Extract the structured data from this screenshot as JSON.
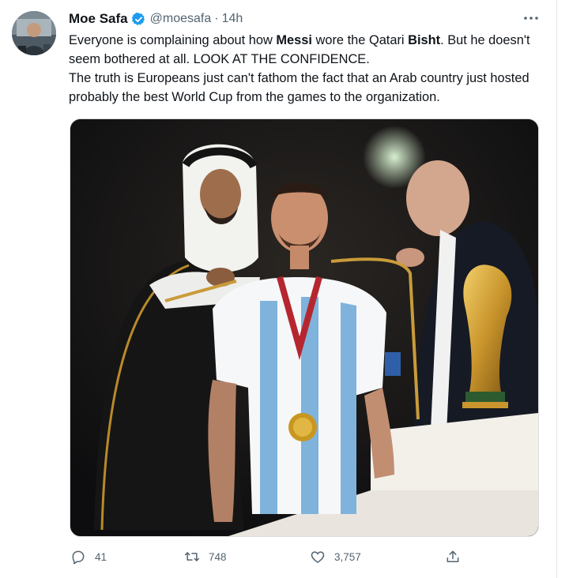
{
  "tweet": {
    "author": {
      "display_name": "Moe Safa",
      "handle": "@moesafa",
      "separator": "·",
      "timestamp": "14h"
    },
    "text": {
      "p1_before_messi": "Everyone is complaining about how ",
      "p1_messi": "Messi",
      "p1_mid": " wore the Qatari ",
      "p1_bisht": "Bisht",
      "p1_after": ". But he doesn't seem bothered at all. LOOK AT THE CONFIDENCE.",
      "p2": "The truth is Europeans just can't fathom the fact that an Arab country just hosted probably the best World Cup from the games to the organization."
    },
    "stats": {
      "replies": "41",
      "retweets": "748",
      "likes": "3,757"
    },
    "colors": {
      "text": "#0f1419",
      "secondary": "#536471",
      "verified": "#1d9bf0"
    }
  },
  "icons": {
    "verified": "verified-badge-icon",
    "more": "more-options-icon",
    "reply": "reply-icon",
    "retweet": "retweet-icon",
    "like": "like-icon",
    "share": "share-icon"
  }
}
